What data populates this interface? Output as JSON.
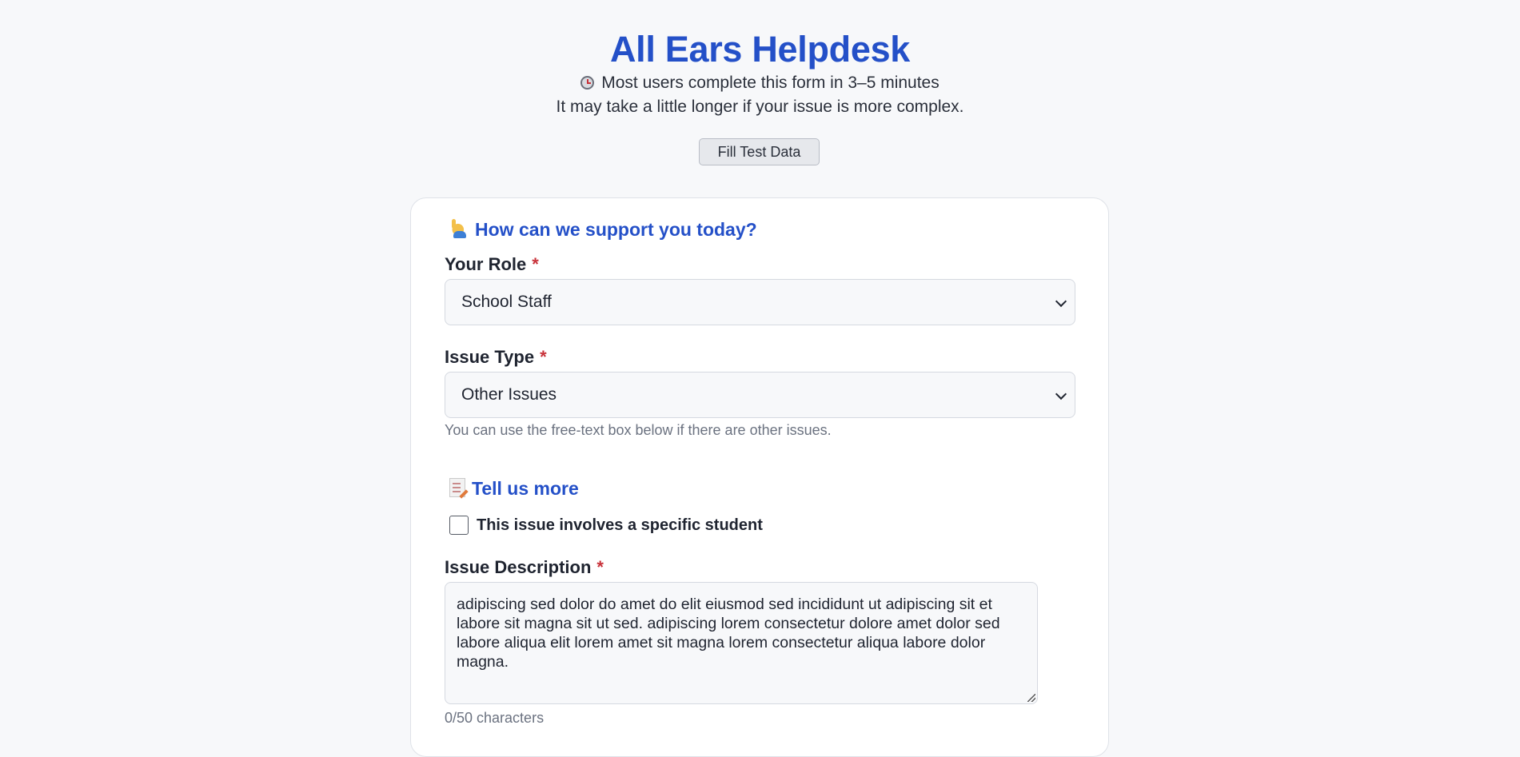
{
  "header": {
    "title": "All Ears Helpdesk",
    "time_note": "Most users complete this form in 3–5 minutes",
    "sub_note": "It may take a little longer if your issue is more complex.",
    "fill_button_label": "Fill Test Data",
    "clock_icon": "clock-icon"
  },
  "support_section": {
    "heading": "How can we support you today?",
    "icon": "raising-hand-icon",
    "role": {
      "label": "Your Role",
      "required_mark": "*",
      "selected": "School Staff"
    },
    "issue_type": {
      "label": "Issue Type",
      "required_mark": "*",
      "selected": "Other Issues",
      "hint": "You can use the free-text box below if there are other issues."
    }
  },
  "details_section": {
    "heading": "Tell us more",
    "icon": "memo-icon",
    "student_checkbox": {
      "label": "This issue involves a specific student",
      "checked": false
    },
    "description": {
      "label": "Issue Description",
      "required_mark": "*",
      "value": "adipiscing sed dolor do amet do elit eiusmod sed incididunt ut adipiscing sit et labore sit magna sit ut sed. adipiscing lorem consectetur dolore amet dolor sed labore aliqua elit lorem amet sit magna lorem consectetur aliqua labore dolor magna.",
      "char_count": "0/50 characters"
    }
  },
  "colors": {
    "accent": "#2450c8",
    "required": "#c8323a",
    "background": "#f7f8fa"
  }
}
